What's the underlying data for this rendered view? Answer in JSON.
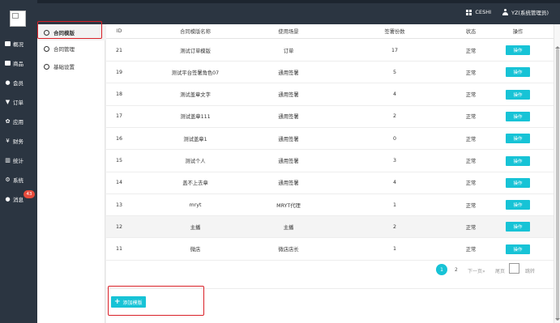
{
  "topbar": {
    "shop_label": "CESHI",
    "user_label": "YZ(系统管理员)"
  },
  "sidebar": {
    "items": [
      {
        "label": "概况",
        "icon": "dashboard-icon"
      },
      {
        "label": "商品",
        "icon": "goods-icon"
      },
      {
        "label": "会员",
        "icon": "users-icon"
      },
      {
        "label": "订单",
        "icon": "cart-icon"
      },
      {
        "label": "应用",
        "icon": "apps-icon"
      },
      {
        "label": "财务",
        "icon": "yen-icon"
      },
      {
        "label": "统计",
        "icon": "chart-icon"
      },
      {
        "label": "系统",
        "icon": "gears-icon"
      },
      {
        "label": "消息",
        "icon": "message-icon"
      }
    ],
    "message_badge": "43"
  },
  "subnav": {
    "items": [
      {
        "label": "合同模版",
        "active": true
      },
      {
        "label": "合同管理",
        "active": false
      },
      {
        "label": "基础设置",
        "active": false
      }
    ]
  },
  "table": {
    "headers": [
      "ID",
      "合同模版名称",
      "使用场景",
      "签署份数",
      "状态",
      "操作"
    ],
    "rows": [
      {
        "id": "21",
        "name": "测试订单模版",
        "scene": "订单",
        "count": "17",
        "status": "正常",
        "action": "操作"
      },
      {
        "id": "19",
        "name": "测试平台签署角色07",
        "scene": "通用签署",
        "count": "5",
        "status": "正常",
        "action": "操作"
      },
      {
        "id": "18",
        "name": "测试盖章文字",
        "scene": "通用签署",
        "count": "4",
        "status": "正常",
        "action": "操作"
      },
      {
        "id": "17",
        "name": "测试盖章111",
        "scene": "通用签署",
        "count": "2",
        "status": "正常",
        "action": "操作"
      },
      {
        "id": "16",
        "name": "测试盖章1",
        "scene": "通用签署",
        "count": "0",
        "status": "正常",
        "action": "操作"
      },
      {
        "id": "15",
        "name": "测试个人",
        "scene": "通用签署",
        "count": "3",
        "status": "正常",
        "action": "操作"
      },
      {
        "id": "14",
        "name": "盖不上去章",
        "scene": "通用签署",
        "count": "4",
        "status": "正常",
        "action": "操作"
      },
      {
        "id": "13",
        "name": "mryt",
        "scene": "MRYT代理",
        "count": "1",
        "status": "正常",
        "action": "操作"
      },
      {
        "id": "12",
        "name": "主播",
        "scene": "主播",
        "count": "2",
        "status": "正常",
        "action": "操作"
      },
      {
        "id": "11",
        "name": "微店",
        "scene": "微店店长",
        "count": "1",
        "status": "正常",
        "action": "操作"
      }
    ]
  },
  "pagination": {
    "current": "1",
    "page2": "2",
    "next": "下一页»",
    "last": "尾页",
    "jump": "跳转"
  },
  "add_button": "添加模版",
  "colors": {
    "accent": "#17c3d6",
    "sidebar_bg": "#2b3541",
    "badge": "#e74c3c",
    "highlight_frame": "#d92027"
  }
}
